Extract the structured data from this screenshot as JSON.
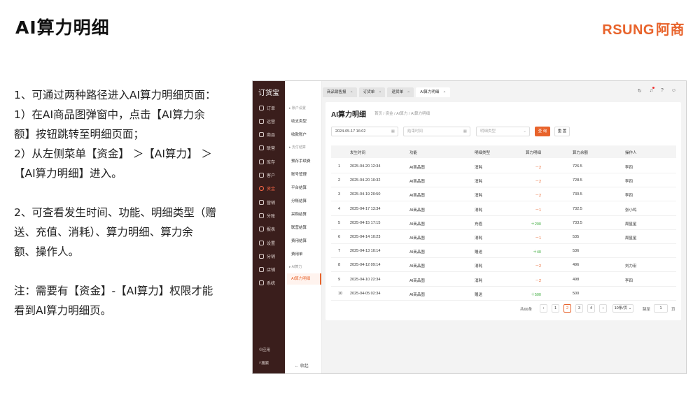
{
  "slide": {
    "title": "AI算力明细",
    "brand_en": "RSUNG",
    "brand_cn": "阿商",
    "lines": [
      "1、可通过两种路径进入AI算力明细页面：",
      "1）在AI商品图弹窗中，点击【AI算力余",
      "额】按钮跳转至明细页面；",
      "2）从左侧菜单【资金】 ＞【AI算力】 ＞",
      "【AI算力明细】进入。",
      "",
      "2、可查看发生时间、功能、明细类型（赠",
      "送、充值、消耗）、算力明细、算力余",
      "额、操作人。",
      "",
      "注：需要有【资金】-【AI算力】权限才能",
      "看到AI算力明细页。"
    ]
  },
  "app": {
    "logo": "订货宝",
    "nav": [
      "订单",
      "运营",
      "商品",
      "联营",
      "库存",
      "客户",
      "资金",
      "营销",
      "分账",
      "报表",
      "设置",
      "分销",
      "店铺",
      "系统"
    ],
    "active_nav": "资金",
    "bottom_nav": [
      "应用",
      "搜索"
    ],
    "subnav": {
      "group1": "账户设置",
      "items1": [
        "收支类型",
        "收款账户"
      ],
      "group2": "支付结算",
      "items2": [
        "预存手续费",
        "账号管理",
        "平台结算",
        "分账结算",
        "采购结算",
        "联营结算",
        "费用结算",
        "费用单"
      ],
      "group3": "AI算力",
      "items3": [
        "AI算力明细"
      ],
      "collapse": "收起"
    },
    "tabs": [
      "商品销售报",
      "订货单",
      "退货单",
      "AI算力明细"
    ],
    "page_title": "AI算力明细",
    "breadcrumb": "首页 / 资金 / AI算力 / AI算力明细",
    "filter": {
      "date_value": "2024-05-17 16:02",
      "end_placeholder": "结束时间",
      "type_placeholder": "明细类型",
      "query": "查 询",
      "reset": "重 置"
    },
    "columns": [
      "发生时间",
      "功能",
      "明细类型",
      "算力明细",
      "算力余额",
      "操作人"
    ],
    "rows": [
      {
        "no": "1",
        "time": "2025-04-20 12:34",
        "func": "AI商品图",
        "type": "消耗",
        "delta": "－2",
        "balance": "726.5",
        "op": "李四"
      },
      {
        "no": "2",
        "time": "2025-04-20 10:32",
        "func": "AI商品图",
        "type": "消耗",
        "delta": "－2",
        "balance": "728.5",
        "op": "李四"
      },
      {
        "no": "3",
        "time": "2025-04-19 20:50",
        "func": "AI商品图",
        "type": "消耗",
        "delta": "－2",
        "balance": "730.5",
        "op": "李四"
      },
      {
        "no": "4",
        "time": "2025-04-17 13:34",
        "func": "AI商品图",
        "type": "消耗",
        "delta": "－1",
        "balance": "732.5",
        "op": "张小鸣"
      },
      {
        "no": "5",
        "time": "2025-04-15 17:15",
        "func": "AI商品图",
        "type": "充值",
        "delta": "＋200",
        "balance": "733.5",
        "op": "周星星"
      },
      {
        "no": "6",
        "time": "2025-04-14 10:23",
        "func": "AI商品图",
        "type": "消耗",
        "delta": "－1",
        "balance": "535",
        "op": "周星星"
      },
      {
        "no": "7",
        "time": "2025-04-13 10:14",
        "func": "AI商品图",
        "type": "赠送",
        "delta": "＋40",
        "balance": "536",
        "op": ""
      },
      {
        "no": "8",
        "time": "2025-04-12 09:14",
        "func": "AI商品图",
        "type": "消耗",
        "delta": "－2",
        "balance": "496",
        "op": "刘力宏"
      },
      {
        "no": "9",
        "time": "2025-04-10 22:34",
        "func": "AI商品图",
        "type": "消耗",
        "delta": "－2",
        "balance": "498",
        "op": "李四"
      },
      {
        "no": "10",
        "time": "2025-04-05 02:34",
        "func": "AI商品图",
        "type": "赠送",
        "delta": "＋500",
        "balance": "500",
        "op": ""
      }
    ],
    "pager": {
      "total": "共66条",
      "pages": [
        "1",
        "2",
        "3",
        "4"
      ],
      "current": "2",
      "page_size": "10条/页",
      "jump_label": "跳至",
      "jump_value": "1",
      "page_unit": "页"
    }
  }
}
